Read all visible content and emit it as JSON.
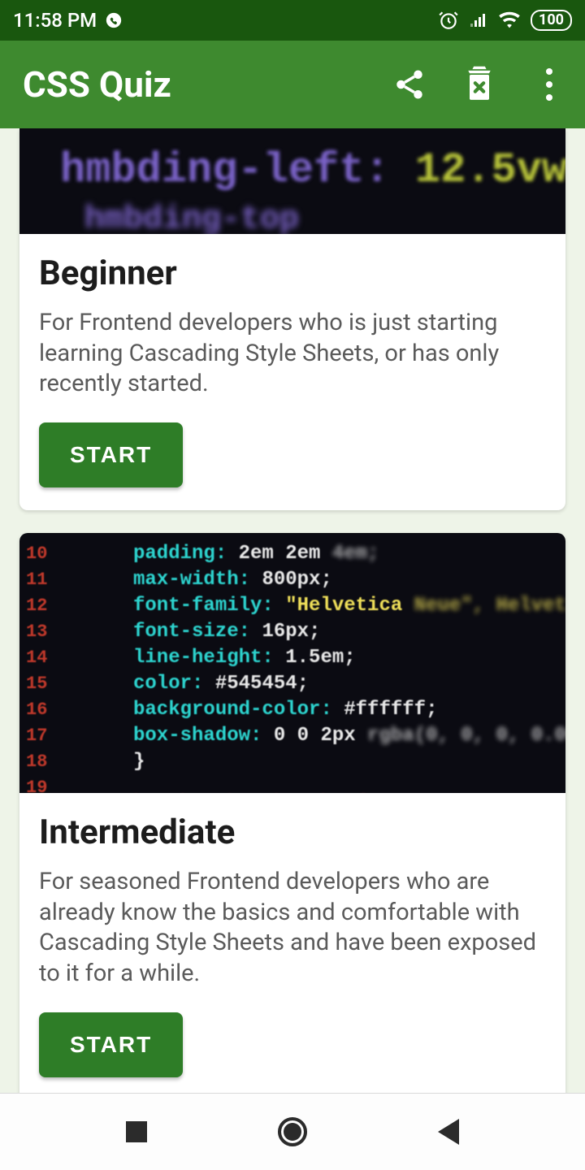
{
  "status": {
    "time": "11:58 PM",
    "battery": "100"
  },
  "appbar": {
    "title": "CSS Quiz"
  },
  "cards": [
    {
      "title": "Beginner",
      "desc": "For Frontend developers who is just starting learning Cascading Style Sheets, or has only recently started.",
      "button": "START"
    },
    {
      "title": "Intermediate",
      "desc": "For seasoned Frontend developers who are already know the basics and comfortable with Cascading Style Sheets and have been exposed to it for a while.",
      "button": "START"
    }
  ]
}
